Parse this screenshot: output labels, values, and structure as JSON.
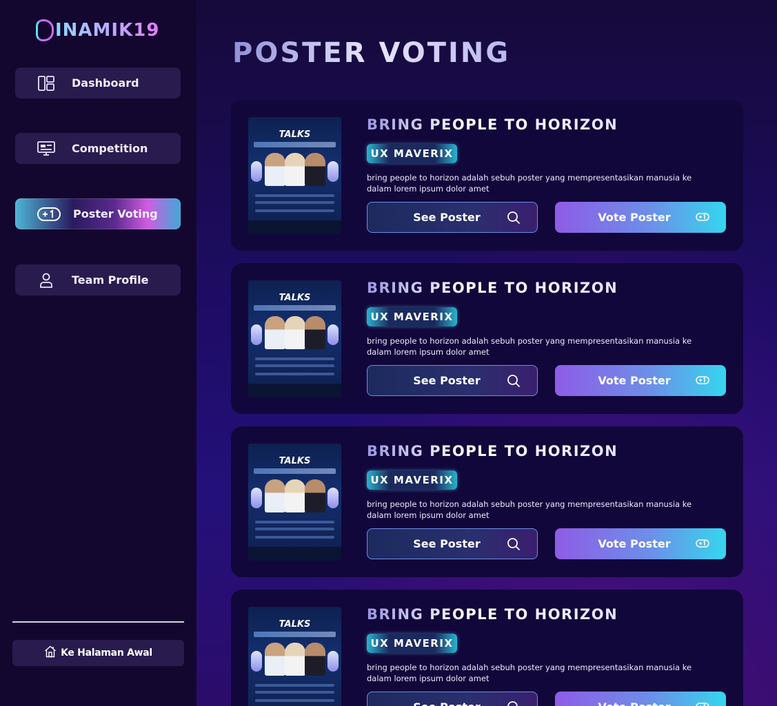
{
  "app": {
    "logo_text": "INAMIK19"
  },
  "sidebar": {
    "items": [
      {
        "label": "Dashboard",
        "icon": "dashboard-icon"
      },
      {
        "label": "Competition",
        "icon": "monitor-icon"
      },
      {
        "label": "Poster Voting",
        "icon": "plus-one-icon",
        "active": true
      },
      {
        "label": "Team Profile",
        "icon": "user-icon"
      }
    ],
    "home_button": {
      "label": "Ke Halaman Awal",
      "icon": "home-icon"
    }
  },
  "main": {
    "title": "POSTER VOTING",
    "posters": [
      {
        "title": "BRING PEOPLE TO HORIZON",
        "team": "UX MAVERIX",
        "description": "bring people to horizon adalah sebuh poster yang mempresentasikan manusia ke dalam lorem ipsum dolor amet",
        "see_label": "See Poster",
        "vote_label": "Vote Poster",
        "thumb_title": "TALKS"
      },
      {
        "title": "BRING PEOPLE TO HORIZON",
        "team": "UX MAVERIX",
        "description": "bring people to horizon adalah sebuh poster yang mempresentasikan manusia ke dalam lorem ipsum dolor amet",
        "see_label": "See Poster",
        "vote_label": "Vote Poster",
        "thumb_title": "TALKS"
      },
      {
        "title": "BRING PEOPLE TO HORIZON",
        "team": "UX MAVERIX",
        "description": "bring people to horizon adalah sebuh poster yang mempresentasikan manusia ke dalam lorem ipsum dolor amet",
        "see_label": "See Poster",
        "vote_label": "Vote Poster",
        "thumb_title": "TALKS"
      },
      {
        "title": "BRING PEOPLE TO HORIZON",
        "team": "UX MAVERIX",
        "description": "bring people to horizon adalah sebuh poster yang mempresentasikan manusia ke dalam lorem ipsum dolor amet",
        "see_label": "See Poster",
        "vote_label": "Vote Poster",
        "thumb_title": "TALKS"
      }
    ]
  },
  "colors": {
    "sidebar_bg": "#13072f",
    "nav_bg": "#2a1b4e",
    "card_bg": "#12073a",
    "accent_cyan": "#35d6ee",
    "accent_purple": "#8e5ce6"
  }
}
